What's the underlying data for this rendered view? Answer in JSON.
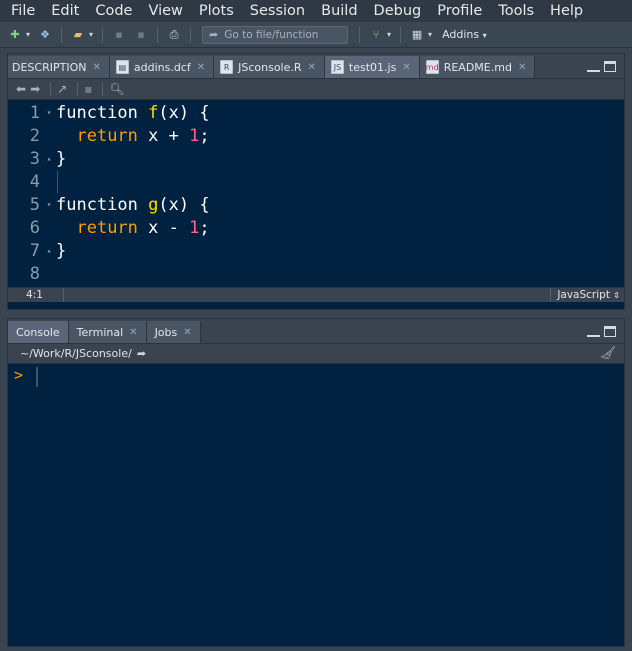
{
  "menu": [
    "File",
    "Edit",
    "Code",
    "View",
    "Plots",
    "Session",
    "Build",
    "Debug",
    "Profile",
    "Tools",
    "Help"
  ],
  "toolbar": {
    "goto_placeholder": "Go to file/function",
    "addins_label": "Addins"
  },
  "editor": {
    "tabs": [
      {
        "label": "DESCRIPTION",
        "active": false
      },
      {
        "label": "addins.dcf",
        "active": false
      },
      {
        "label": "JSconsole.R",
        "active": false
      },
      {
        "label": "test01.js",
        "active": true
      },
      {
        "label": "README.md",
        "active": false
      }
    ],
    "lines": [
      {
        "n": "1"
      },
      {
        "n": "2"
      },
      {
        "n": "3"
      },
      {
        "n": "4"
      },
      {
        "n": "5"
      },
      {
        "n": "6"
      },
      {
        "n": "7"
      },
      {
        "n": "8"
      }
    ],
    "code": {
      "l1_kw": "function",
      "l1_fn": "f",
      "l1_rest": "(x) {",
      "l2_ret": "return",
      "l2_mid": " x + ",
      "l2_num": "1",
      "l2_end": ";",
      "l3": "}",
      "l5_kw": "function",
      "l5_fn": "g",
      "l5_rest": "(x) {",
      "l6_ret": "return",
      "l6_mid": " x - ",
      "l6_num": "1",
      "l6_end": ";",
      "l7": "}"
    },
    "cursor_position": "4:1",
    "language": "JavaScript"
  },
  "console": {
    "tabs": [
      {
        "label": "Console",
        "active": true
      },
      {
        "label": "Terminal",
        "active": false
      },
      {
        "label": "Jobs",
        "active": false
      }
    ],
    "path": "~/Work/R/JSconsole/",
    "prompt": ">"
  },
  "colors": {
    "editor_bg": "#002240",
    "keyword": "#ffffff",
    "function_name": "#ffdd00",
    "return_kw": "#ff9d00",
    "number": "#ff628c"
  }
}
